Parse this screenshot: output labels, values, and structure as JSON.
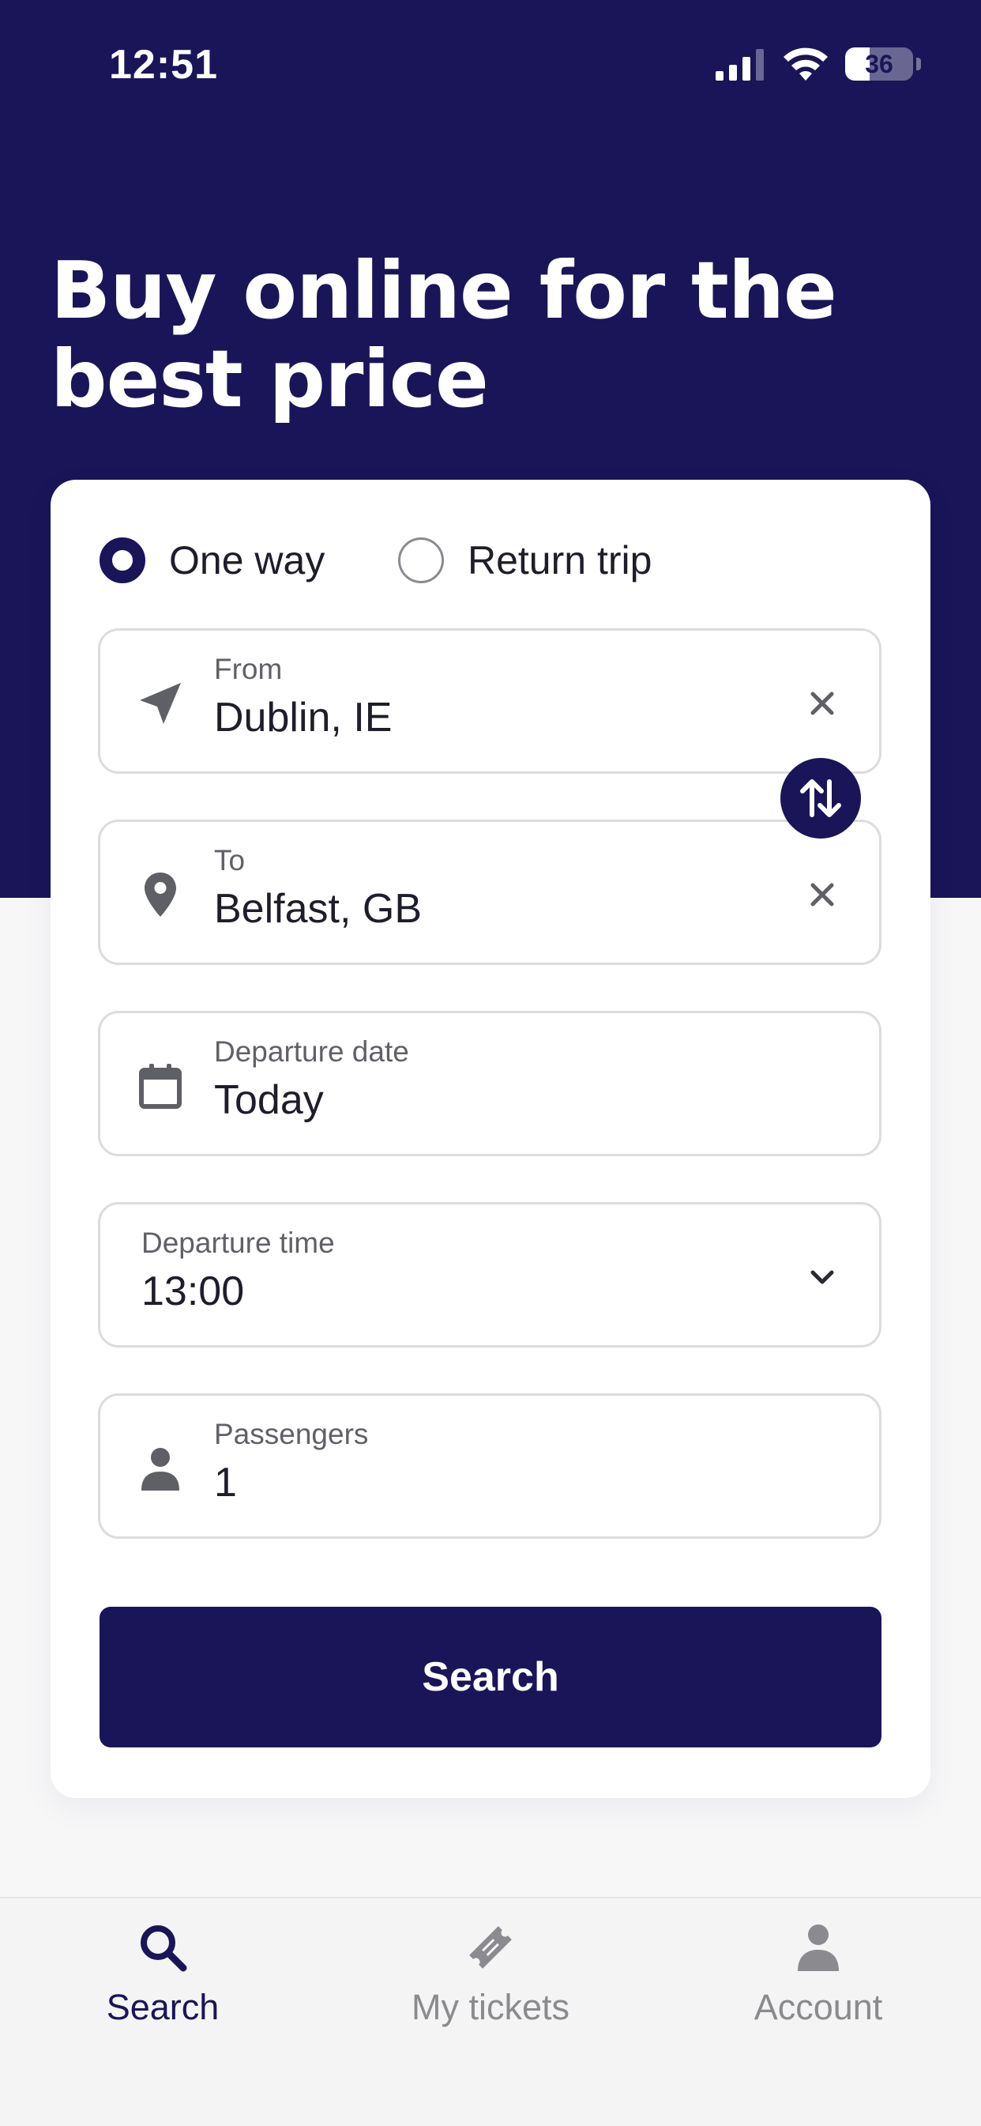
{
  "status_bar": {
    "time": "12:51",
    "battery": "36",
    "battery_level": 0.36
  },
  "hero": {
    "headline": "Buy online for the best price"
  },
  "trip_type": {
    "options": [
      {
        "label": "One way",
        "selected": true
      },
      {
        "label": "Return trip",
        "selected": false
      }
    ]
  },
  "form": {
    "from": {
      "label": "From",
      "value": "Dublin, IE",
      "icon": "navigation-arrow-icon"
    },
    "to": {
      "label": "To",
      "value": "Belfast, GB",
      "icon": "map-pin-icon"
    },
    "date": {
      "label": "Departure date",
      "value": "Today",
      "icon": "calendar-icon"
    },
    "time": {
      "label": "Departure time",
      "value": "13:00",
      "icon": "chevron-down-icon"
    },
    "passengers": {
      "label": "Passengers",
      "value": "1",
      "icon": "person-icon"
    },
    "swap_icon": "swap-vertical-icon",
    "search_label": "Search"
  },
  "tab_bar": {
    "tabs": [
      {
        "label": "Search",
        "icon": "search-icon",
        "active": true
      },
      {
        "label": "My tickets",
        "icon": "ticket-icon",
        "active": false
      },
      {
        "label": "Account",
        "icon": "person-icon",
        "active": false
      }
    ]
  },
  "colors": {
    "brand": "#1a1558",
    "background": "#f7f7f8",
    "inactive_tab": "#8a8a8f",
    "field_border": "#dcdce0"
  }
}
